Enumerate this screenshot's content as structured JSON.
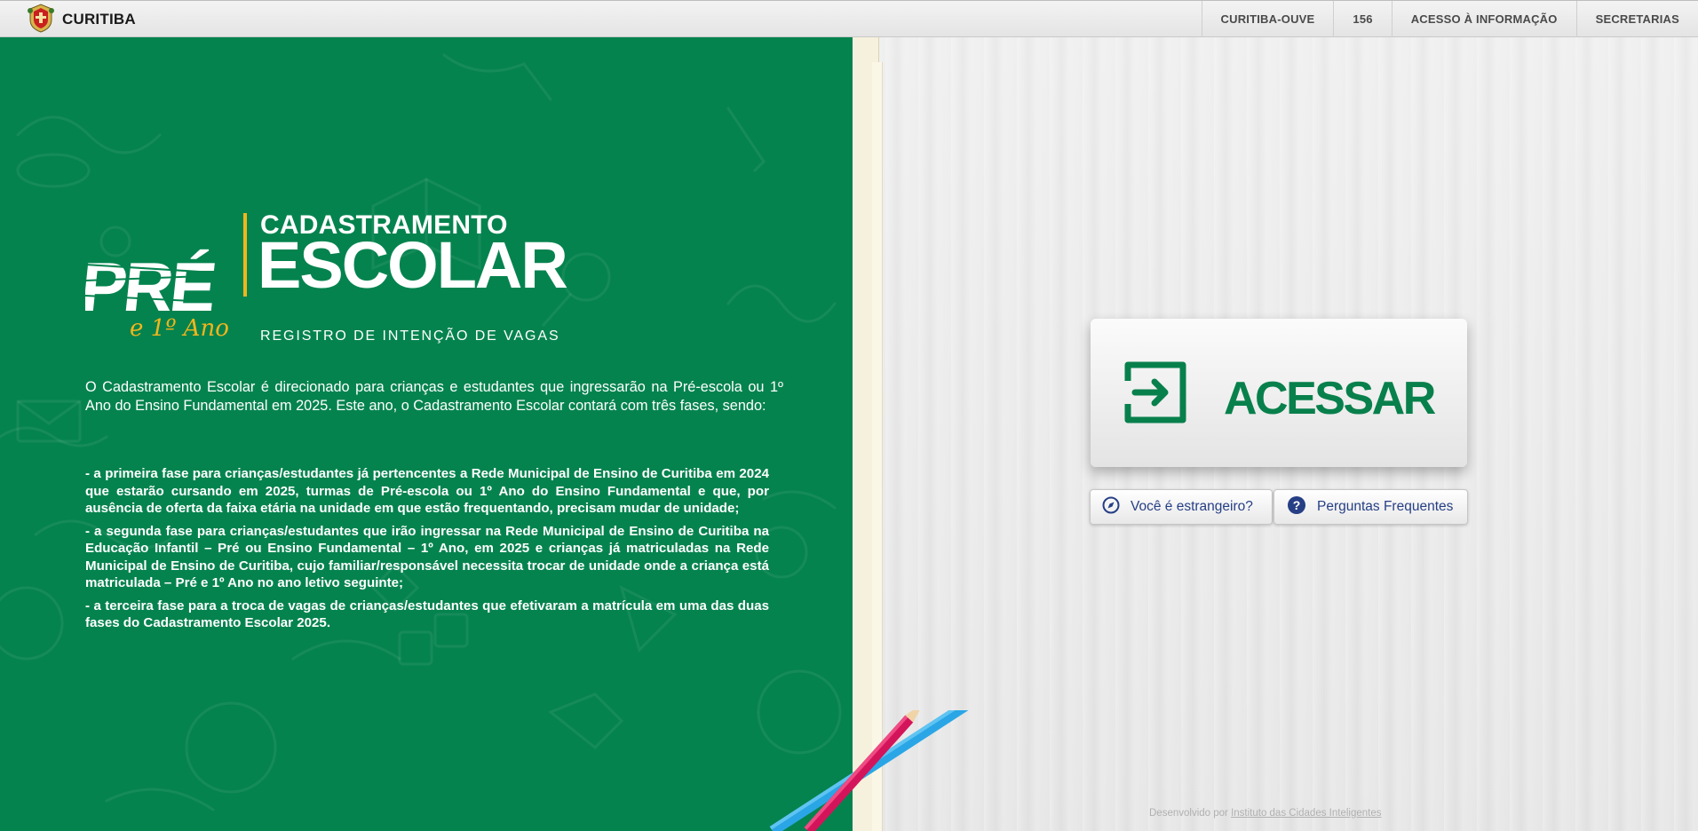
{
  "topbar": {
    "brand": "CURITIBA",
    "nav": [
      "CURITIBA-OUVE",
      "156",
      "ACESSO À INFORMAÇÃO",
      "SECRETARIAS"
    ]
  },
  "hero": {
    "logo": {
      "pre": "PRÉ",
      "ano": "e 1º Ano",
      "line1": "CADASTRAMENTO",
      "line2": "ESCOLAR",
      "line3": "REGISTRO DE INTENÇÃO DE VAGAS"
    },
    "intro": "O Cadastramento Escolar é direcionado para crianças e estudantes que ingressarão na Pré-escola ou 1º Ano do Ensino Fundamental em 2025. Este ano, o Cadastramento Escolar contará com três fases, sendo:",
    "phases": [
      {
        "prefix": "- a ",
        "strong": "primeira fase",
        "text": " para crianças/estudantes já pertencentes a Rede Municipal de Ensino de Curitiba em 2024 que estarão cursando em 2025, turmas de Pré-escola ou 1º Ano do Ensino Fundamental e que, por ausência de oferta da faixa etária na unidade em que estão frequentando, precisam mudar de unidade;"
      },
      {
        "prefix": "- a ",
        "strong": "segunda fase",
        "text": " para crianças/estudantes que irão ingressar na Rede Municipal de Ensino de Curitiba na Educação Infantil – Pré ou Ensino Fundamental – 1º Ano, em 2025 e crianças já matriculadas na Rede Municipal de Ensino de Curitiba, cujo familiar/responsável necessita trocar de unidade onde a criança está matriculada – Pré e 1º Ano no ano letivo seguinte;"
      },
      {
        "prefix": "- a ",
        "strong": "terceira fase",
        "text": " para a troca de vagas de crianças/estudantes que efetivaram a matrícula em uma das duas fases do Cadastramento Escolar 2025."
      }
    ]
  },
  "actions": {
    "acessar": "ACESSAR",
    "estrangeiro": "Você é estrangeiro?",
    "faq": "Perguntas Frequentes"
  },
  "footer": {
    "prefix": "Desenvolvido por ",
    "link": "Instituto das Cidades Inteligentes"
  },
  "colors": {
    "green": "#05834e",
    "accent_yellow": "#f2b51c",
    "button_text_blue": "#263f85"
  },
  "icons": [
    "curitiba-coat-of-arms-icon",
    "login-arrow-icon",
    "compass-icon",
    "question-circle-icon"
  ]
}
